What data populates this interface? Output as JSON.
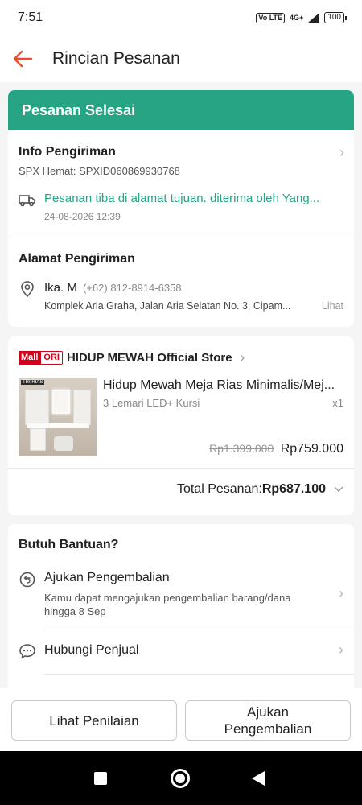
{
  "status_bar": {
    "time": "7:51",
    "volte": "Vo LTE",
    "network": "4G+",
    "battery": "100"
  },
  "header": {
    "title": "Rincian Pesanan"
  },
  "order_status": {
    "banner": "Pesanan Selesai"
  },
  "shipping_info": {
    "title": "Info Pengiriman",
    "courier": "SPX Hemat: SPXID060869930768",
    "status": "Pesanan tiba di alamat tujuan. diterima oleh Yang...",
    "datetime": "24-08-2026 12:39"
  },
  "address": {
    "title": "Alamat Pengiriman",
    "name": "Ika. M",
    "phone": "(+62) 812-8914-6358",
    "detail": "Komplek Aria Graha, Jalan Aria Selatan No. 3, Cipam...",
    "more": "Lihat"
  },
  "store": {
    "badge_left": "Mall",
    "badge_right": "ORI",
    "name": "HIDUP MEWAH Official Store"
  },
  "product": {
    "name": "Hidup Mewah Meja Rias Minimalis/Mej...",
    "variant": "3 Lemari LED+ Kursi",
    "qty": "x1",
    "original_price": "Rp1.399.000",
    "price": "Rp759.000",
    "image_caption": "TRI RIAS"
  },
  "total": {
    "label": "Total Pesanan: ",
    "value": "Rp687.100"
  },
  "help": {
    "title": "Butuh Bantuan?",
    "items": [
      {
        "label": "Ajukan Pengembalian",
        "sub": "Kamu dapat mengajukan pengembalian barang/dana hingga 8 Sep"
      },
      {
        "label": "Hubungi Penjual"
      }
    ]
  },
  "buttons": {
    "review": "Lihat Penilaian",
    "return": "Ajukan Pengembalian"
  }
}
